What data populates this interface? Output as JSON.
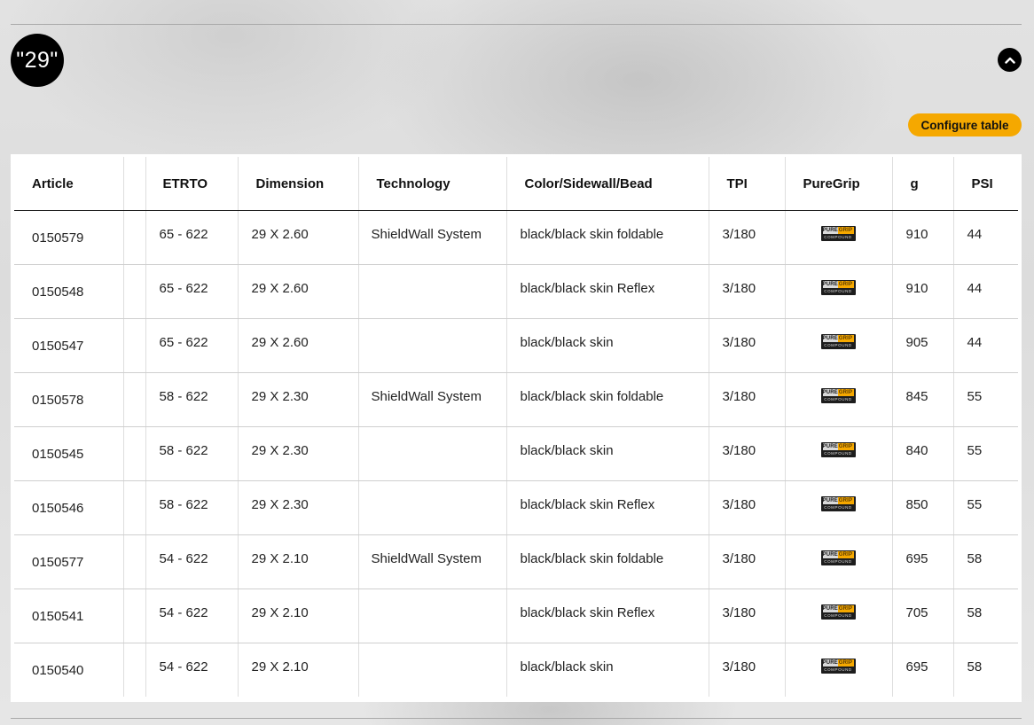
{
  "section": {
    "size_label": "\"29\"",
    "configure_label": "Configure table",
    "collapse_icon": "chevron-up-icon"
  },
  "table": {
    "headers": {
      "article": "Article",
      "spacer": "",
      "etrto": "ETRTO",
      "dimension": "Dimension",
      "technology": "Technology",
      "color": "Color/Sidewall/Bead",
      "tpi": "TPI",
      "puregrip": "PureGrip",
      "weight": "g",
      "psi": "PSI"
    },
    "puregrip_logo": {
      "word1": "PURE",
      "word2": "GRIP",
      "word3": "COMPOUND",
      "colors": {
        "dark": "#1d1d1d",
        "grey": "#d9d9d9",
        "orange": "#f5a800"
      }
    },
    "rows": [
      {
        "article": "0150579",
        "etrto": "65 - 622",
        "dimension": "29 X 2.60",
        "technology": "ShieldWall System",
        "color": "black/black skin foldable",
        "tpi": "3/180",
        "weight": "910",
        "psi": "44"
      },
      {
        "article": "0150548",
        "etrto": "65 - 622",
        "dimension": "29 X 2.60",
        "technology": "",
        "color": "black/black skin Reflex",
        "tpi": "3/180",
        "weight": "910",
        "psi": "44"
      },
      {
        "article": "0150547",
        "etrto": "65 - 622",
        "dimension": "29 X 2.60",
        "technology": "",
        "color": "black/black skin",
        "tpi": "3/180",
        "weight": "905",
        "psi": "44"
      },
      {
        "article": "0150578",
        "etrto": "58 - 622",
        "dimension": "29 X 2.30",
        "technology": "ShieldWall System",
        "color": "black/black skin foldable",
        "tpi": "3/180",
        "weight": "845",
        "psi": "55"
      },
      {
        "article": "0150545",
        "etrto": "58 - 622",
        "dimension": "29 X 2.30",
        "technology": "",
        "color": "black/black skin",
        "tpi": "3/180",
        "weight": "840",
        "psi": "55"
      },
      {
        "article": "0150546",
        "etrto": "58 - 622",
        "dimension": "29 X 2.30",
        "technology": "",
        "color": "black/black skin Reflex",
        "tpi": "3/180",
        "weight": "850",
        "psi": "55"
      },
      {
        "article": "0150577",
        "etrto": "54 - 622",
        "dimension": "29 X 2.10",
        "technology": "ShieldWall System",
        "color": "black/black skin foldable",
        "tpi": "3/180",
        "weight": "695",
        "psi": "58"
      },
      {
        "article": "0150541",
        "etrto": "54 - 622",
        "dimension": "29 X 2.10",
        "technology": "",
        "color": "black/black skin Reflex",
        "tpi": "3/180",
        "weight": "705",
        "psi": "58"
      },
      {
        "article": "0150540",
        "etrto": "54 - 622",
        "dimension": "29 X 2.10",
        "technology": "",
        "color": "black/black skin",
        "tpi": "3/180",
        "weight": "695",
        "psi": "58"
      }
    ]
  },
  "colors": {
    "accent": "#f5a800",
    "badge": "#000000",
    "panel": "#ffffff"
  }
}
